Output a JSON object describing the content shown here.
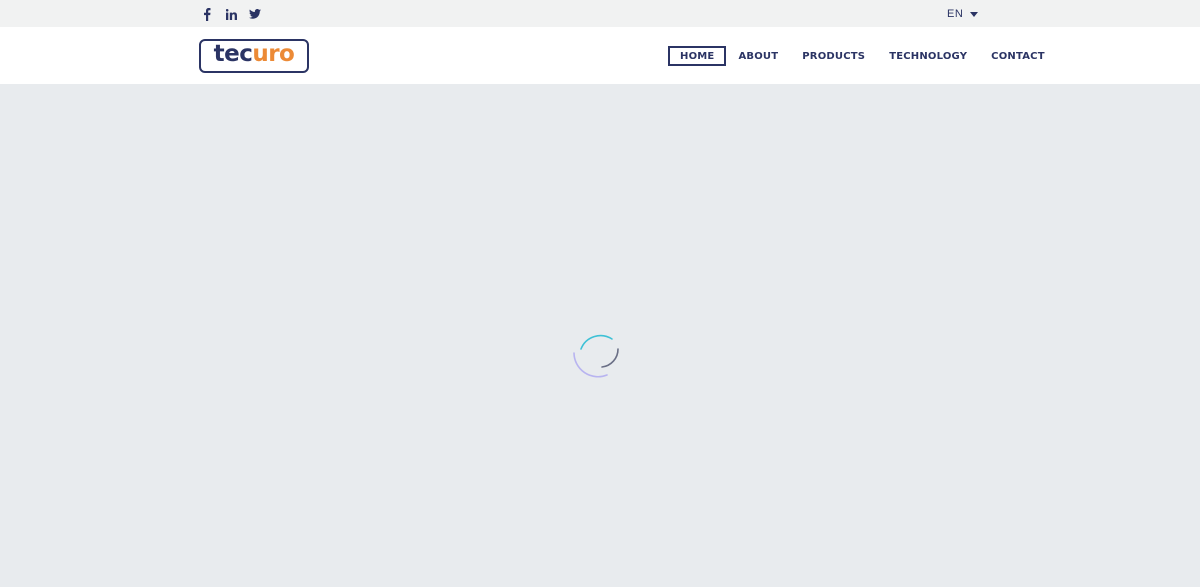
{
  "topbar": {
    "social": [
      {
        "name": "facebook-icon",
        "glyph": "f"
      },
      {
        "name": "linkedin-icon",
        "glyph": "in"
      },
      {
        "name": "twitter-icon",
        "glyph": "bird"
      }
    ],
    "language": {
      "label": "EN"
    }
  },
  "header": {
    "logo": {
      "part1": "tec",
      "part2": "uro"
    },
    "nav": [
      {
        "label": "HOME",
        "active": true
      },
      {
        "label": "ABOUT",
        "active": false
      },
      {
        "label": "PRODUCTS",
        "active": false
      },
      {
        "label": "TECHNOLOGY",
        "active": false
      },
      {
        "label": "CONTACT",
        "active": false
      }
    ]
  },
  "main": {
    "loading_icon": "loading-spinner-icon"
  },
  "colors": {
    "brand_navy": "#2b3464",
    "brand_orange": "#ec8a36",
    "topbar_bg": "#f1f2f2",
    "header_bg": "#ffffff",
    "content_bg": "#e8ebee",
    "spinner_cyan": "#3ec1d6",
    "spinner_violet": "#b8b4f0"
  }
}
